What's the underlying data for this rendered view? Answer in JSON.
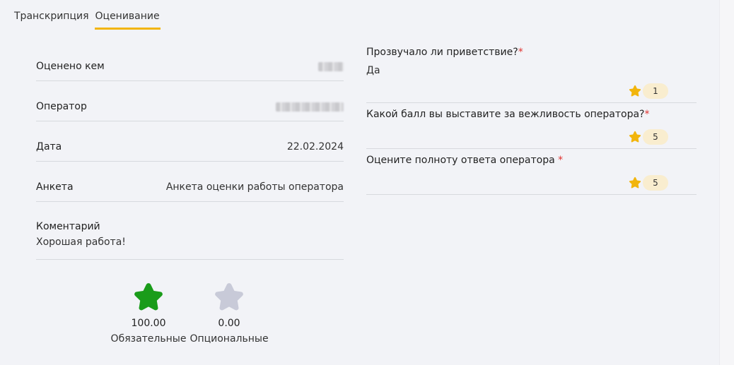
{
  "tabs": [
    {
      "label": "Транскрипция",
      "active": false
    },
    {
      "label": "Оценивание",
      "active": true
    }
  ],
  "info": {
    "rated_by_label": "Оценено кем",
    "operator_label": "Оператор",
    "date_label": "Дата",
    "date_value": "22.02.2024",
    "survey_label": "Анкета",
    "survey_value": "Анкета оценки работы оператора",
    "comment_label": "Коментарий",
    "comment_value": "Хорошая работа!"
  },
  "summary": {
    "mandatory_value": "100.00",
    "mandatory_label": "Обязательные",
    "mandatory_color": "#1a9c1a",
    "optional_value": "0.00",
    "optional_label": "Опциональные",
    "optional_color": "#c8cad8"
  },
  "questions": [
    {
      "title": "Прозвучало ли приветствие?",
      "required_mark": "*",
      "answer": "Да",
      "score": "1"
    },
    {
      "title": "Какой балл вы выставите за вежливость оператора?",
      "required_mark": "*",
      "answer": "",
      "score": "5"
    },
    {
      "title": "Оцените полноту ответа оператора ",
      "required_mark": "*",
      "answer": "",
      "score": "5"
    }
  ],
  "colors": {
    "accent": "#f2b50c",
    "required": "#e0322f",
    "score_bg": "#f9edcf"
  },
  "icons": {
    "score_icon": "star-icon",
    "summary_icon": "star-icon"
  }
}
